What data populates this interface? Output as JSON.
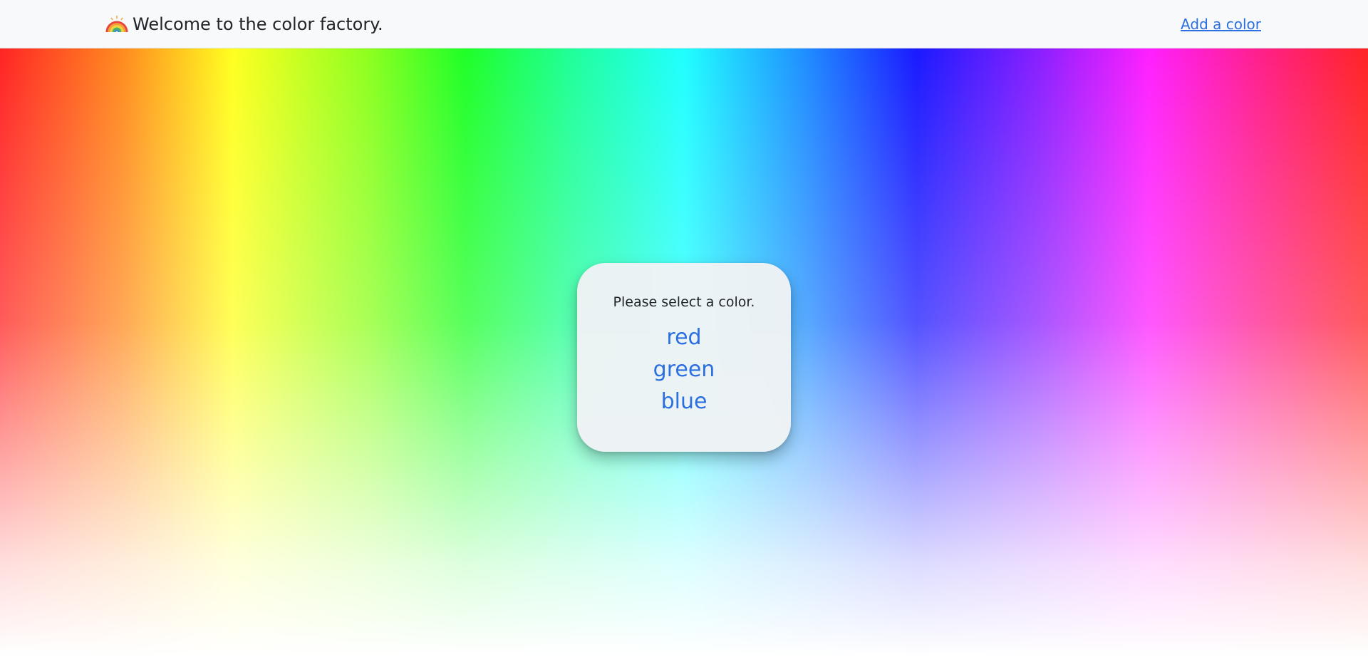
{
  "header": {
    "brand_icon": "rainbow-icon",
    "brand_text": "Welcome to the color factory.",
    "add_color_link": "Add a color"
  },
  "card": {
    "prompt": "Please select a color.",
    "colors": [
      "red",
      "green",
      "blue"
    ]
  },
  "theme": {
    "link_color": "#2b6fe0",
    "navbar_bg": "#f8f9fa",
    "card_bg": "#f0f3f5",
    "text_color": "#212529"
  }
}
